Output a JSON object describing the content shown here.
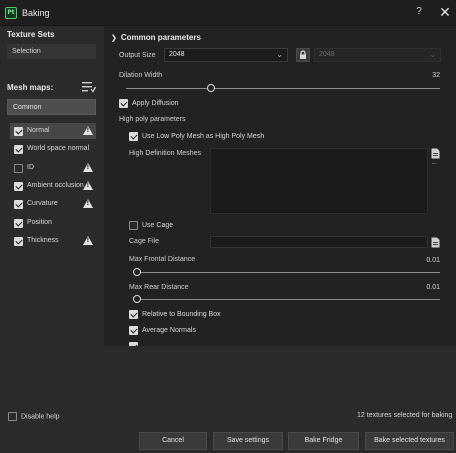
{
  "window": {
    "app_icon_text": "Pt",
    "title": "Baking",
    "help_label": "?",
    "close_label": "✕"
  },
  "left": {
    "texture_sets_heading": "Texture Sets",
    "texture_sets": [
      {
        "label": "Selection"
      }
    ],
    "mesh_maps_heading": "Mesh maps:",
    "mesh_maps_icon": "list-settings-icon",
    "common_label": "Common",
    "maps": [
      {
        "label": "Normal",
        "checked": true,
        "warning": true,
        "selected": true
      },
      {
        "label": "World space normal",
        "checked": true,
        "warning": false,
        "selected": false
      },
      {
        "label": "ID",
        "checked": false,
        "warning": true,
        "selected": false
      },
      {
        "label": "Ambient occlusion",
        "checked": true,
        "warning": true,
        "selected": false
      },
      {
        "label": "Curvature",
        "checked": true,
        "warning": true,
        "selected": false
      },
      {
        "label": "Position",
        "checked": true,
        "warning": false,
        "selected": false
      },
      {
        "label": "Thickness",
        "checked": true,
        "warning": true,
        "selected": false
      }
    ]
  },
  "common": {
    "section_title": "Common parameters",
    "output_size_label": "Output Size",
    "output_size_value": "2048",
    "output_size_locked_value": "2048",
    "dilation_width_label": "Dilation Width",
    "dilation_width_value": "32",
    "dilation_width_fraction": 0.27,
    "apply_diffusion_label": "Apply Diffusion",
    "apply_diffusion_checked": true,
    "high_poly_heading": "High poly parameters",
    "use_low_poly_label": "Use Low Poly Mesh as High Poly Mesh",
    "use_low_poly_checked": true,
    "hd_meshes_label": "High Definition Meshes",
    "hd_meshes_minus": "–",
    "use_cage_label": "Use Cage",
    "use_cage_checked": false,
    "cage_file_label": "Cage File",
    "max_frontal_label": "Max Frontal Distance",
    "max_frontal_value": "0.01",
    "max_rear_label": "Max Rear Distance",
    "max_rear_value": "0.01",
    "relative_bbox_label": "Relative to Bounding Box",
    "relative_bbox_checked": true,
    "average_normals_label": "Average Normals",
    "average_normals_checked": true,
    "cut_off_checked": true
  },
  "footer": {
    "disable_help_label": "Disable help",
    "disable_help_checked": false,
    "status": "12 textures selected for baking",
    "cancel": "Cancel",
    "save_settings": "Save settings",
    "bake_fridge": "Bake Fridge",
    "bake_selected": "Bake selected textures"
  },
  "colors": {
    "background": "#2b2b2b",
    "panel": "#222222",
    "titlebar": "#1f1f1f",
    "accent_icon": "#5fc46e"
  }
}
